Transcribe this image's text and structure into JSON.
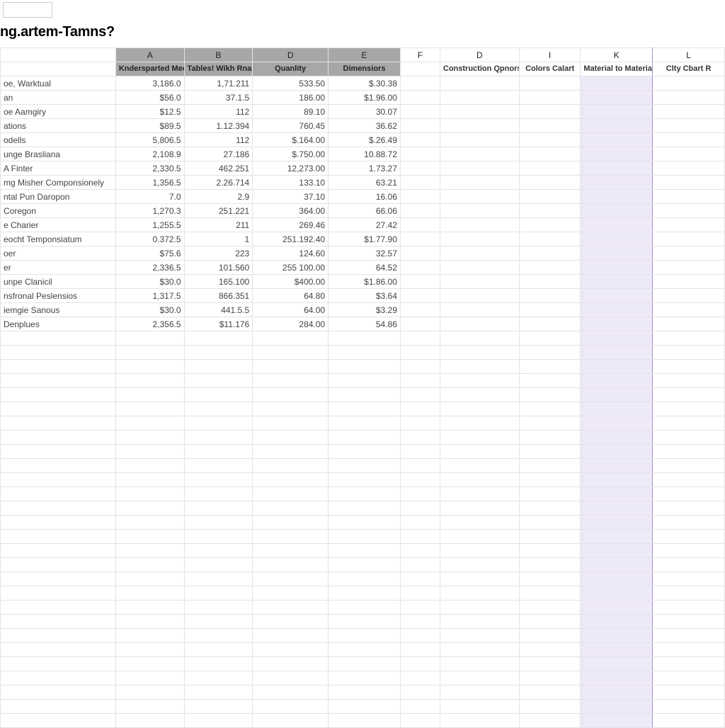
{
  "formula": {
    "name_box": ""
  },
  "title": "ng.artem-Tamns?",
  "columns": {
    "letters": [
      "",
      "A",
      "B",
      "D",
      "E",
      "F",
      "D",
      "I",
      "K",
      "L"
    ],
    "headers": [
      "",
      "Kndersparted Meovannered Onale",
      "Tables! Wikh Rnairs",
      "Quanlity",
      "Dimensiors",
      "",
      "Construction Qpnors",
      "Colors Calart",
      "Material to Materials",
      "Clty Cbart R"
    ]
  },
  "rows": [
    {
      "label": "oe, Warktual",
      "a": "3,186.0",
      "b": "1,71.211",
      "d": "533.50",
      "e": "$.30.38"
    },
    {
      "label": "an",
      "a": "$56.0",
      "b": "37.1.5",
      "d": "186.00",
      "e": "$1.96.00"
    },
    {
      "label": "oe Aamgiry",
      "a": "$12.5",
      "b": "112",
      "d": "89.10",
      "e": "30.07"
    },
    {
      "label": "ations",
      "a": "$89.5",
      "b": "1.12.394",
      "d": "760.45",
      "e": "36.62"
    },
    {
      "label": "odells",
      "a": "5,806.5",
      "b": "112",
      "d": "$.164.00",
      "e": "$.26.49"
    },
    {
      "label": "unge Brasliana",
      "a": "2,108.9",
      "b": "27.186",
      "d": "$.750.00",
      "e": "10.88.72"
    },
    {
      "label": "A Finter",
      "a": "2,330.5",
      "b": "462.251",
      "d": "12,273.00",
      "e": "1.73.27"
    },
    {
      "label": "mg Misher Componsionely",
      "a": "1,356.5",
      "b": "2.26.714",
      "d": "133.10",
      "e": "63.21"
    },
    {
      "label": "ntal Pun Daropon",
      "a": "7.0",
      "b": "2.9",
      "d": "37.10",
      "e": "16.06"
    },
    {
      "label": "Coregon",
      "a": "1,270.3",
      "b": "251.221",
      "d": "364.00",
      "e": "66.06"
    },
    {
      "label": "e Charier",
      "a": "1,255.5",
      "b": "211",
      "d": "269.46",
      "e": "27.42"
    },
    {
      "label": "eocht Temponsiatum",
      "a": "0.372.5",
      "b": "1",
      "d": "251.192.40",
      "e": "$1.77.90"
    },
    {
      "label": "oer",
      "a": "$75.6",
      "b": "223",
      "d": "124.60",
      "e": "32.57"
    },
    {
      "label": "er",
      "a": "2,336.5",
      "b": "101.560",
      "d": "255 100.00",
      "e": "64.52"
    },
    {
      "label": "unpe Clanicil",
      "a": "$30.0",
      "b": "165.100",
      "d": "$400.00",
      "e": "$1.86.00"
    },
    {
      "label": "nsfronal Peslensios",
      "a": "1,317.5",
      "b": "866.351",
      "d": "64.80",
      "e": "$3.64"
    },
    {
      "label": "iemgie Sanous",
      "a": "$30.0",
      "b": "441.5.5",
      "d": "64.00",
      "e": "$3.29"
    },
    {
      "label": "Denplues",
      "a": "2,356.5",
      "b": "$11.176",
      "d": "284.00",
      "e": "54.86"
    }
  ],
  "blank_rows": 28
}
